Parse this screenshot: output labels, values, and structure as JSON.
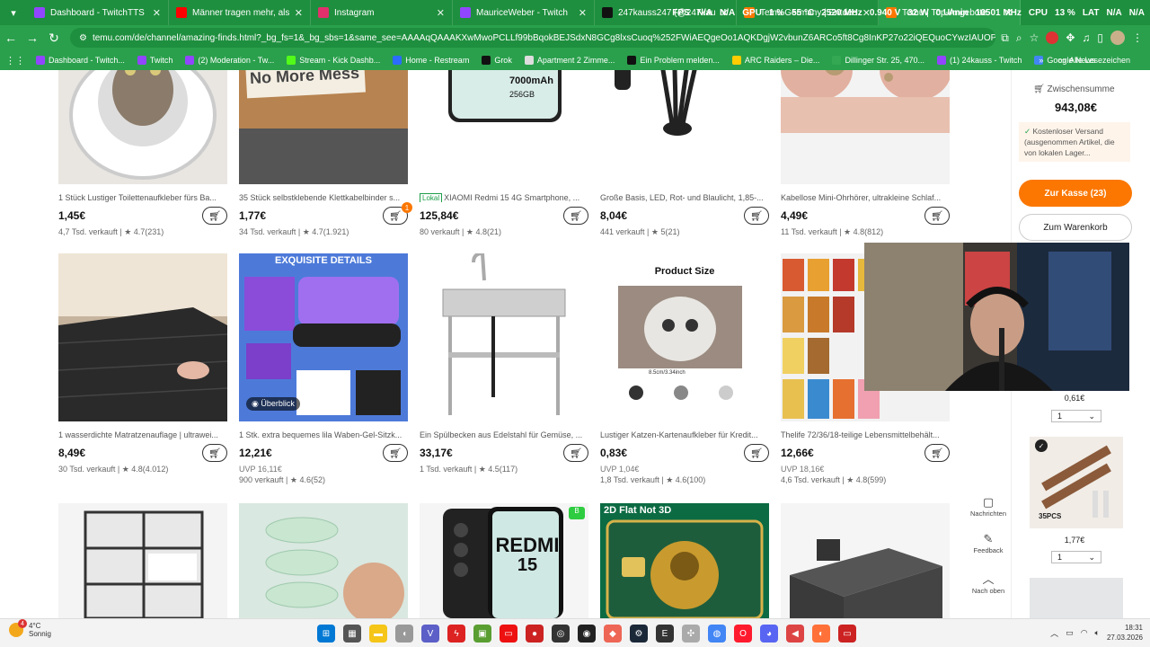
{
  "browser": {
    "tabs": [
      {
        "title": "Dashboard - TwitchTTS",
        "color": "#9146ff",
        "active": false
      },
      {
        "title": "Männer tragen mehr, als sie zei",
        "color": "#ff0000",
        "active": false
      },
      {
        "title": "Instagram",
        "color": "#e1306c",
        "active": false
      },
      {
        "title": "MauriceWeber - Twitch",
        "color": "#9146ff",
        "active": false
      },
      {
        "title": "247kauss247 (@247kauss247)",
        "color": "#111111",
        "active": false
      },
      {
        "title": "Temu Germany | Entdecke Lo",
        "color": "#fb7701",
        "active": false
      },
      {
        "title": "Temu | Top-Angebote",
        "color": "#fb7701",
        "active": true
      }
    ],
    "hud": [
      "FPS",
      "N/A",
      "N/A",
      "GPU",
      "1 %",
      "55 °C",
      "2520 MHz",
      "0.940 V",
      "32 W",
      "0 U/min",
      "10501 MHz",
      "CPU",
      "13 %",
      "LAT",
      "N/A",
      "N/A"
    ],
    "url": "temu.com/de/channel/amazing-finds.html?_bg_fs=1&_bg_sbs=1&same_see=AAAAqQAAAKXwMwoPCLLf99bBqokBEJSdxN8GCg8lxsCuoq%252FWiAEQgeOo1AQKDgjW2vbunZ6ARCo5ft8Cg8InKP27o22iQEQuoCYwzIAUOPV2aG8Mg...",
    "bookmarks": [
      {
        "label": "Dashboard - Twitch...",
        "color": "#9146ff"
      },
      {
        "label": "Twitch",
        "color": "#9146ff"
      },
      {
        "label": "(2) Moderation - Tw...",
        "color": "#9146ff"
      },
      {
        "label": "Stream - Kick Dashb...",
        "color": "#53fc18"
      },
      {
        "label": "Home - Restream",
        "color": "#2b6bff"
      },
      {
        "label": "Grok",
        "color": "#111111"
      },
      {
        "label": "Apartment 2 Zimme...",
        "color": "#dddddd"
      },
      {
        "label": "Ein Problem melden...",
        "color": "#111111"
      },
      {
        "label": "ARC Raiders – Die...",
        "color": "#ffcc00"
      },
      {
        "label": "Dillinger Str. 25, 470...",
        "color": "#34a853"
      },
      {
        "label": "(1) 24kauss - Twitch",
        "color": "#9146ff"
      },
      {
        "label": "Google News",
        "color": "#4285f4"
      }
    ],
    "bookmarks_more": "»",
    "all_bookmarks": "Alle Lesezeichen"
  },
  "products": [
    {
      "title": "1 Stück Lustiger Toilettenaufkleber fürs Ba...",
      "price": "1,45€",
      "uvp": "",
      "sold": "4,7 Tsd. verkauft",
      "rating": "★ 4.7(231)",
      "lokal": "",
      "badge": ""
    },
    {
      "title": "35 Stück selbstklebende Klettkabelbinder s...",
      "price": "1,77€",
      "uvp": "",
      "sold": "34 Tsd. verkauft",
      "rating": "★ 4.7(1.921)",
      "lokal": "",
      "badge": "1"
    },
    {
      "title": "XIAOMI Redmi 15 4G Smartphone, ...",
      "price": "125,84€",
      "uvp": "",
      "sold": "80 verkauft",
      "rating": "★ 4.8(21)",
      "lokal": "Lokal",
      "badge": ""
    },
    {
      "title": "Große Basis, LED, Rot- und Blaulicht, 1,85-...",
      "price": "8,04€",
      "uvp": "",
      "sold": "441 verkauft",
      "rating": "★ 5(21)",
      "lokal": "",
      "badge": ""
    },
    {
      "title": "Kabellose Mini-Ohrhörer, ultrakleine Schlaf...",
      "price": "4,49€",
      "uvp": "",
      "sold": "11 Tsd. verkauft",
      "rating": "★ 4.8(812)",
      "lokal": "",
      "badge": ""
    },
    {
      "title": "1 wasserdichte Matratzenauflage | ultrawei...",
      "price": "8,49€",
      "uvp": "",
      "sold": "30 Tsd. verkauft",
      "rating": "★ 4.8(4.012)",
      "lokal": "",
      "badge": ""
    },
    {
      "title": "1 Stk. extra bequemes lila Waben-Gel-Sitzk...",
      "price": "12,21€",
      "uvp": "UVP 16,11€",
      "sold": "900 verkauft",
      "rating": "★ 4.6(52)",
      "lokal": "",
      "badge": ""
    },
    {
      "title": "Ein Spülbecken aus Edelstahl für Gemüse, ...",
      "price": "33,17€",
      "uvp": "",
      "sold": "1 Tsd. verkauft",
      "rating": "★ 4.5(117)",
      "lokal": "",
      "badge": ""
    },
    {
      "title": "Lustiger Katzen-Kartenaufkleber für Kredit...",
      "price": "0,83€",
      "uvp": "UVP 1,04€",
      "sold": "1,8 Tsd. verkauft",
      "rating": "★ 4.6(100)",
      "lokal": "",
      "badge": ""
    },
    {
      "title": "Thelife 72/36/18-teilige Lebensmittelbehält...",
      "price": "12,66€",
      "uvp": "UVP 18,16€",
      "sold": "4,6 Tsd. verkauft",
      "rating": "★ 4.8(599)",
      "lokal": "",
      "badge": ""
    }
  ],
  "image_texts": {
    "no_more_mess": "No More Mess",
    "redmi": "REDMI",
    "redmi_num": "15",
    "redmi_specs": "7000mAh",
    "redmi_storage": "256GB",
    "exquisite": "EXQUISITE DETAILS",
    "product_size": "Product Size",
    "ueberblick": "Überblick",
    "card_2d": "2D Flat Not 3D",
    "size_label": "8.5cm/3.34inch",
    "lokal_badge_b": "B"
  },
  "cart": {
    "subtotal_label": "Zwischensumme",
    "subtotal": "943,08€",
    "shipping": "Kostenloser Versand (ausgenommen Artikel, die von lokalen Lager...",
    "checkout_label": "Zur Kasse (23)",
    "tocart_label": "Zum Warenkorb",
    "items": [
      {
        "price": "0,61€",
        "qty": "1"
      },
      {
        "price": "1,77€",
        "qty": "1",
        "tag": "35PCS"
      }
    ]
  },
  "floating": {
    "messages": "Nachrichten",
    "feedback": "Feedback",
    "top": "Nach oben"
  },
  "taskbar": {
    "temp": "4°C",
    "weather": "Sonnig",
    "notif": "4",
    "time": "18:31",
    "date": "27.03.2026"
  }
}
